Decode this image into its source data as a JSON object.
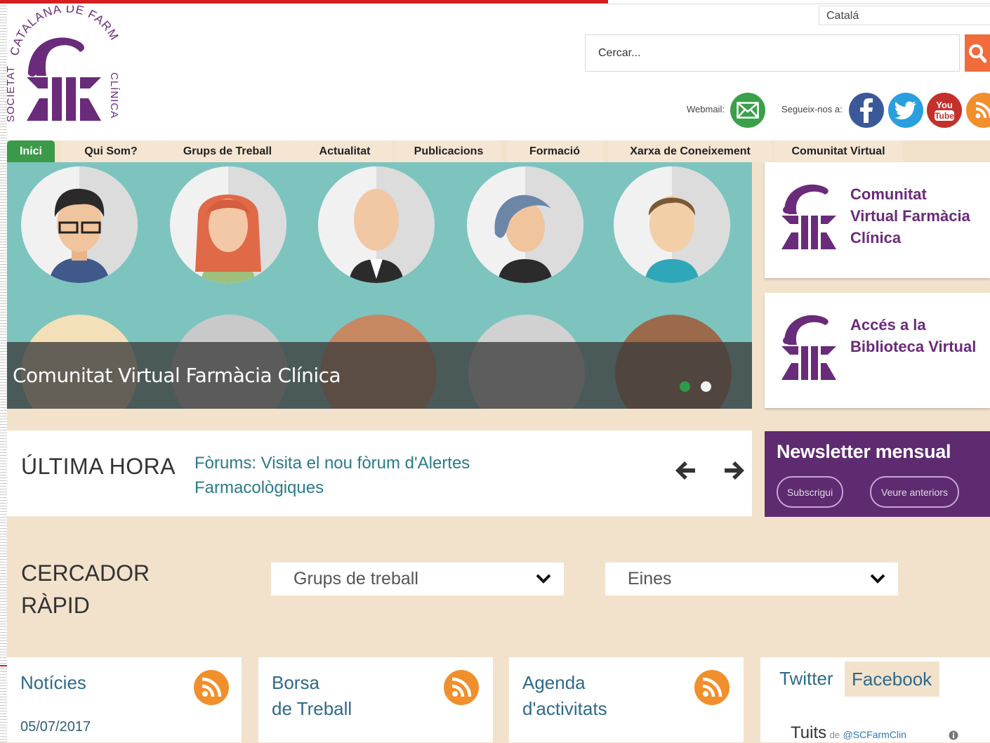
{
  "top": {
    "language": "Catalá",
    "search_placeholder": "Cercar...",
    "webmail_label": "Webmail:",
    "follow_label": "Segueix-nos a:"
  },
  "logo": {
    "text_top": "CATALANA DE FARMÀCIA",
    "text_left": "SOCIETAT",
    "text_right": "CLÍNICA"
  },
  "nav": {
    "items": [
      {
        "label": "Inici"
      },
      {
        "label": "Qui Som?"
      },
      {
        "label": "Grups de Treball"
      },
      {
        "label": "Actualitat"
      },
      {
        "label": "Publicacions"
      },
      {
        "label": "Formació"
      },
      {
        "label": "Xarxa de Coneixement"
      },
      {
        "label": "Comunitat Virtual"
      }
    ]
  },
  "slider": {
    "caption": "Comunitat Virtual Farmàcia Clínica",
    "active_dot": 1,
    "dot_count": 2
  },
  "side_cards": [
    {
      "title_lines": [
        "Comunitat",
        "Virtual Farmàcia",
        "Clínica"
      ]
    },
    {
      "title_lines": [
        "Accés a la",
        "Biblioteca Virtual"
      ]
    }
  ],
  "news": {
    "label": "ÚLTIMA HORA",
    "headline_lines": [
      "Fòrums: Visita el nou fòrum d'Alertes",
      "Farmacològiques"
    ]
  },
  "newsletter": {
    "title": "Newsletter mensual",
    "subscribe": "Subscrigui",
    "previous": "Veure anteriors"
  },
  "quick_search": {
    "title_lines": [
      "CERCADOR",
      "RÀPID"
    ],
    "select_groups": "Grups de treball",
    "select_tools": "Eines"
  },
  "cards": {
    "news": {
      "title_lines": [
        "Notícies"
      ],
      "date": "05/07/2017"
    },
    "jobs": {
      "title_lines": [
        "Borsa",
        "de Treball"
      ]
    },
    "agenda": {
      "title_lines": [
        "Agenda",
        "d'activitats"
      ]
    },
    "social": {
      "tab_twitter": "Twitter",
      "tab_facebook": "Facebook",
      "tweets": "Tuits",
      "tweets_by": "de",
      "handle": "@SCFarmClin"
    }
  },
  "colors": {
    "brand_purple": "#6a2b7a",
    "accent_orange": "#f26b3a",
    "nav_active": "#3a9a48",
    "background": "#f2e2cc"
  }
}
